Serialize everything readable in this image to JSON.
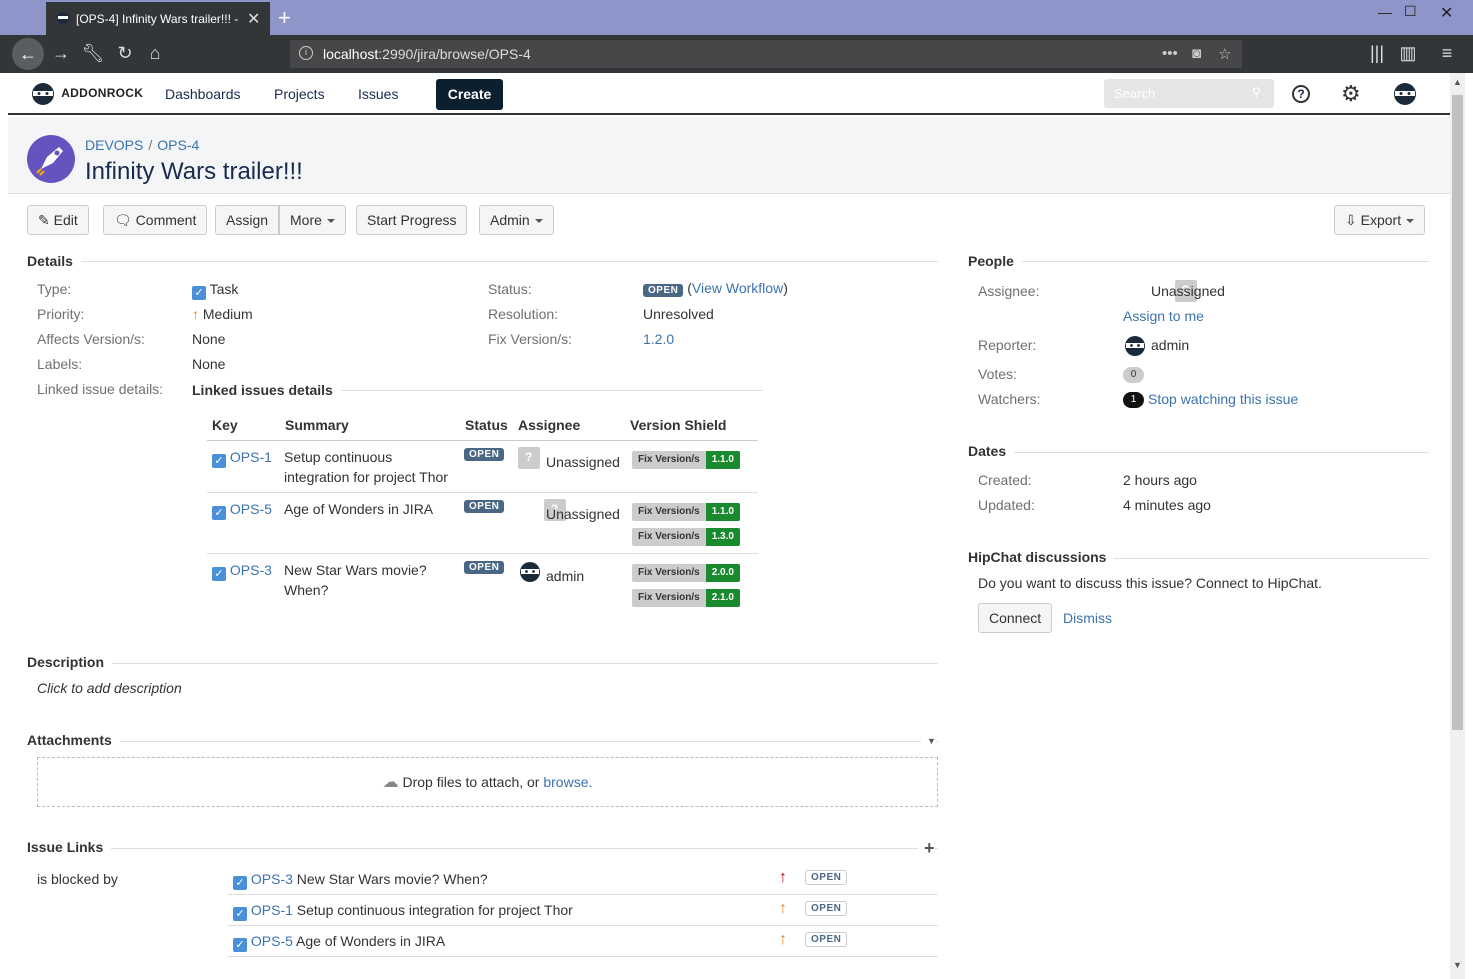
{
  "browser": {
    "tab_title": "[OPS-4] Infinity Wars trailer!!! - ",
    "url_host": "localhost",
    "url_path": ":2990/jira/browse/OPS-4"
  },
  "header": {
    "logo": "ADDONROCK",
    "nav": [
      "Dashboards",
      "Projects",
      "Issues"
    ],
    "create": "Create",
    "search_placeholder": "Search"
  },
  "issue": {
    "project": "DEVOPS",
    "key": "OPS-4",
    "summary": "Infinity Wars trailer!!!"
  },
  "ops": {
    "edit": "Edit",
    "comment": "Comment",
    "assign": "Assign",
    "more": "More",
    "start_progress": "Start Progress",
    "admin": "Admin",
    "export": "Export"
  },
  "details": {
    "title": "Details",
    "type_label": "Type:",
    "type": "Task",
    "priority_label": "Priority:",
    "priority": "Medium",
    "affects_label": "Affects Version/s:",
    "affects": "None",
    "labels_label": "Labels:",
    "labels": "None",
    "linked_label": "Linked issue details:",
    "status_label": "Status:",
    "status": "OPEN",
    "view_workflow": "View Workflow",
    "resolution_label": "Resolution:",
    "resolution": "Unresolved",
    "fix_label": "Fix Version/s:",
    "fix": "1.2.0"
  },
  "linked": {
    "title": "Linked issues details",
    "headers": [
      "Key",
      "Summary",
      "Status",
      "Assignee",
      "Version Shield"
    ],
    "shield_key": "Fix Version/s",
    "rows": [
      {
        "key": "OPS-1",
        "summary1": "Setup continuous",
        "summary2": "integration for project Thor",
        "status": "OPEN",
        "assignee": "Unassigned",
        "versions": [
          "1.1.0"
        ]
      },
      {
        "key": "OPS-5",
        "summary1": "Age of Wonders in JIRA",
        "summary2": "",
        "status": "OPEN",
        "assignee": "Unassigned",
        "versions": [
          "1.1.0",
          "1.3.0"
        ]
      },
      {
        "key": "OPS-3",
        "summary1": "New Star Wars movie?",
        "summary2": "When?",
        "status": "OPEN",
        "assignee": "admin",
        "versions": [
          "2.0.0",
          "2.1.0"
        ]
      }
    ]
  },
  "description": {
    "title": "Description",
    "placeholder": "Click to add description"
  },
  "attachments": {
    "title": "Attachments",
    "drop": "Drop files to attach, or ",
    "browse": "browse."
  },
  "issue_links": {
    "title": "Issue Links",
    "relation": "is blocked by",
    "rows": [
      {
        "key": "OPS-3",
        "summary": "New Star Wars movie? When?",
        "status": "OPEN",
        "priority_color": "#cc0000"
      },
      {
        "key": "OPS-1",
        "summary": "Setup continuous integration for project Thor",
        "status": "OPEN",
        "priority_color": "#e98125"
      },
      {
        "key": "OPS-5",
        "summary": "Age of Wonders in JIRA",
        "status": "OPEN",
        "priority_color": "#e98125"
      }
    ]
  },
  "people": {
    "title": "People",
    "assignee_label": "Assignee:",
    "assignee": "Unassigned",
    "assign_to_me": "Assign to me",
    "reporter_label": "Reporter:",
    "reporter": "admin",
    "votes_label": "Votes:",
    "votes": "0",
    "watchers_label": "Watchers:",
    "watchers": "1",
    "stop_watching": "Stop watching this issue"
  },
  "dates": {
    "title": "Dates",
    "created_label": "Created:",
    "created": "2 hours ago",
    "updated_label": "Updated:",
    "updated": "4 minutes ago"
  },
  "hipchat": {
    "title": "HipChat discussions",
    "text": "Do you want to discuss this issue? Connect to HipChat.",
    "connect": "Connect",
    "dismiss": "Dismiss"
  }
}
